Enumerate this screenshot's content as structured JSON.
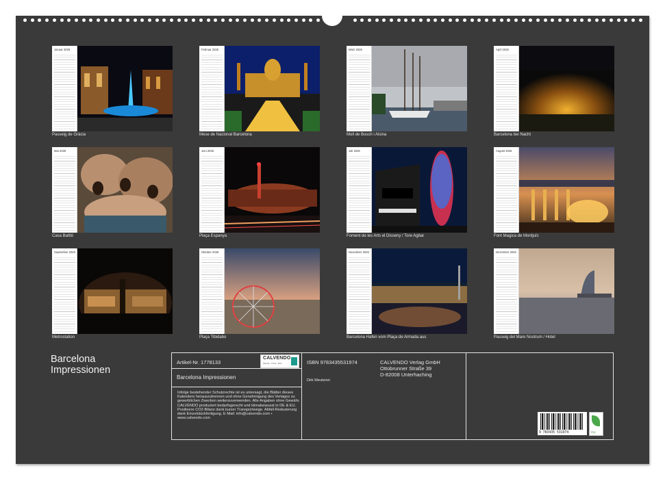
{
  "calendar": {
    "title_line1": "Barcelona",
    "title_line2": "Impressionen"
  },
  "months": [
    {
      "name": "Januar 2025",
      "caption": "Passeig de Gràcia"
    },
    {
      "name": "Februar 2025",
      "caption": "Mese de Nacional Barcelona"
    },
    {
      "name": "März 2025",
      "caption": "Moll de Bosch i Alsina"
    },
    {
      "name": "April 2025",
      "caption": "Barcelona bei Nacht"
    },
    {
      "name": "Mai 2025",
      "caption": "Casa Battló"
    },
    {
      "name": "Juni 2025",
      "caption": "Plaça Espanya"
    },
    {
      "name": "Juli 2025",
      "caption": "Foment de les Arts el Disseny / Tore Agbar"
    },
    {
      "name": "August 2025",
      "caption": "Font Magica de Montjuïc"
    },
    {
      "name": "September 2025",
      "caption": "Metrostation"
    },
    {
      "name": "Oktober 2025",
      "caption": "Plaça Tibidabo"
    },
    {
      "name": "November 2025",
      "caption": "Barcelona Hafen vom Plaça de Armada aus"
    },
    {
      "name": "Dezember 2025",
      "caption": "Passeig del Mare Nostrum / Hotel"
    }
  ],
  "info": {
    "article": "Artikel-Nr. 1778133",
    "calvendo_logo": "CALVENDO",
    "calvendo_tag": "Kalender · Puzzle · Buch",
    "product_title": "Barcelona Impressionen",
    "isbn": "ISBN 9783435531974",
    "author": "Dirk Meutzner",
    "publisher_line1": "CALVENDO Verlag GmbH",
    "publisher_line2": "Ottobrunner Straße 39",
    "publisher_line3": "D-82008 Unterhaching",
    "legal": "Infolge bestehender Schutzrechte ist es untersagt, die Blätter dieses Kalenders herauszutrennen und ohne Genehmigung des Verlages zu gewerblichen Zwecken weiterzuverwenden. Alle Angaben ohne Gewähr. CALVENDO produziert bedarfsgerecht und klimabewusst in DE & EU. Positivere CO2-Bilanz dank kurzer Transportwege. Abfall-Reduzierung dank Einzelstückfertigung. E-Mail: info@calvendo.com • www.calvendo.com",
    "barcode_number": "9 783435 531974",
    "eco_label": "FSC"
  }
}
